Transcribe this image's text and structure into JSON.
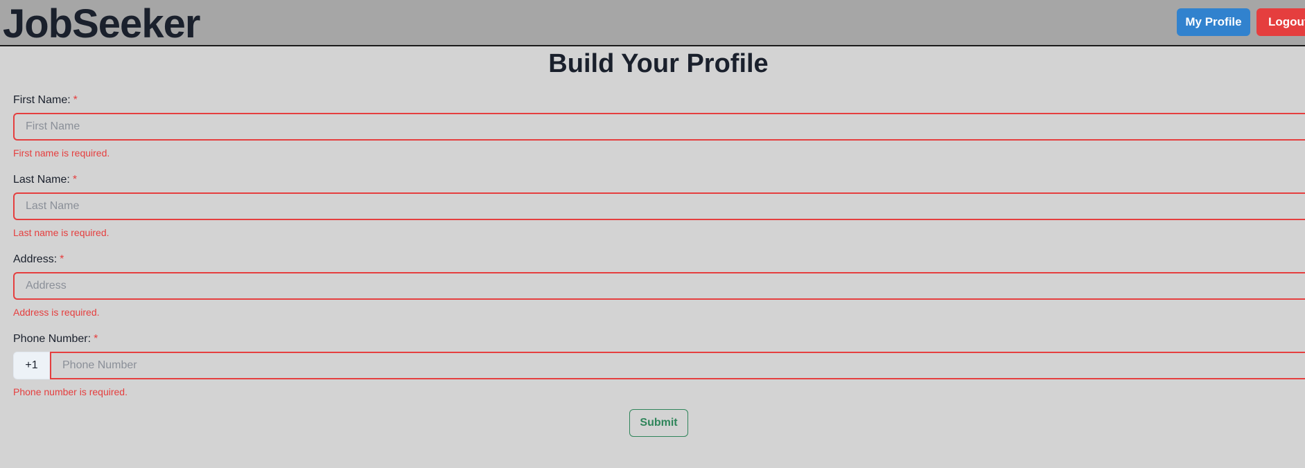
{
  "header": {
    "brand": "JobSeeker",
    "my_profile_label": "My Profile",
    "logout_label": "Logout"
  },
  "page": {
    "title": "Build Your Profile"
  },
  "form": {
    "required_marker": "*",
    "first_name": {
      "label": "First Name:",
      "placeholder": "First Name",
      "value": "",
      "error": "First name is required."
    },
    "last_name": {
      "label": "Last Name:",
      "placeholder": "Last Name",
      "value": "",
      "error": "Last name is required."
    },
    "address": {
      "label": "Address:",
      "placeholder": "Address",
      "value": "",
      "error": "Address is required."
    },
    "phone": {
      "label": "Phone Number:",
      "country_code": "+1",
      "placeholder": "Phone Number",
      "value": "",
      "error": "Phone number is required."
    },
    "submit_label": "Submit"
  },
  "colors": {
    "background": "#d3d3d3",
    "header_background": "#a6a6a6",
    "primary_button": "#3182ce",
    "danger": "#e53e3e",
    "success": "#2f855a"
  }
}
